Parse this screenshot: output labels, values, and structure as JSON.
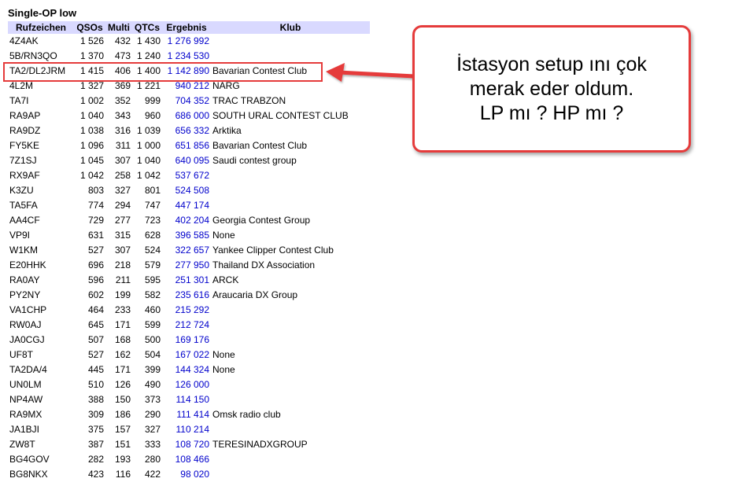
{
  "page": {
    "title": "Single-OP low"
  },
  "table": {
    "headers": [
      "Rufzeichen",
      "QSOs",
      "Multi",
      "QTCs",
      "Ergebnis",
      "Klub"
    ],
    "rows": [
      {
        "call": "4Z4AK",
        "qsos": "1 526",
        "multi": "432",
        "qtcs": "1 430",
        "score": "1 276 992",
        "club": ""
      },
      {
        "call": "5B/RN3QO",
        "qsos": "1 370",
        "multi": "473",
        "qtcs": "1 240",
        "score": "1 234 530",
        "club": ""
      },
      {
        "call": "TA2/DL2JRM",
        "qsos": "1 415",
        "multi": "406",
        "qtcs": "1 400",
        "score": "1 142 890",
        "club": "Bavarian Contest Club"
      },
      {
        "call": "4L2M",
        "qsos": "1 327",
        "multi": "369",
        "qtcs": "1 221",
        "score": "940 212",
        "club": "NARG"
      },
      {
        "call": "TA7I",
        "qsos": "1 002",
        "multi": "352",
        "qtcs": "999",
        "score": "704 352",
        "club": "TRAC TRABZON"
      },
      {
        "call": "RA9AP",
        "qsos": "1 040",
        "multi": "343",
        "qtcs": "960",
        "score": "686 000",
        "club": "SOUTH URAL CONTEST CLUB"
      },
      {
        "call": "RA9DZ",
        "qsos": "1 038",
        "multi": "316",
        "qtcs": "1 039",
        "score": "656 332",
        "club": "Arktika"
      },
      {
        "call": "FY5KE",
        "qsos": "1 096",
        "multi": "311",
        "qtcs": "1 000",
        "score": "651 856",
        "club": "Bavarian Contest Club"
      },
      {
        "call": "7Z1SJ",
        "qsos": "1 045",
        "multi": "307",
        "qtcs": "1 040",
        "score": "640 095",
        "club": "Saudi contest group"
      },
      {
        "call": "RX9AF",
        "qsos": "1 042",
        "multi": "258",
        "qtcs": "1 042",
        "score": "537 672",
        "club": ""
      },
      {
        "call": "K3ZU",
        "qsos": "803",
        "multi": "327",
        "qtcs": "801",
        "score": "524 508",
        "club": ""
      },
      {
        "call": "TA5FA",
        "qsos": "774",
        "multi": "294",
        "qtcs": "747",
        "score": "447 174",
        "club": ""
      },
      {
        "call": "AA4CF",
        "qsos": "729",
        "multi": "277",
        "qtcs": "723",
        "score": "402 204",
        "club": "Georgia Contest Group"
      },
      {
        "call": "VP9I",
        "qsos": "631",
        "multi": "315",
        "qtcs": "628",
        "score": "396 585",
        "club": "None"
      },
      {
        "call": "W1KM",
        "qsos": "527",
        "multi": "307",
        "qtcs": "524",
        "score": "322 657",
        "club": "Yankee Clipper Contest Club"
      },
      {
        "call": "E20HHK",
        "qsos": "696",
        "multi": "218",
        "qtcs": "579",
        "score": "277 950",
        "club": "Thailand DX Association"
      },
      {
        "call": "RA0AY",
        "qsos": "596",
        "multi": "211",
        "qtcs": "595",
        "score": "251 301",
        "club": "ARCK"
      },
      {
        "call": "PY2NY",
        "qsos": "602",
        "multi": "199",
        "qtcs": "582",
        "score": "235 616",
        "club": "Araucaria DX Group"
      },
      {
        "call": "VA1CHP",
        "qsos": "464",
        "multi": "233",
        "qtcs": "460",
        "score": "215 292",
        "club": ""
      },
      {
        "call": "RW0AJ",
        "qsos": "645",
        "multi": "171",
        "qtcs": "599",
        "score": "212 724",
        "club": ""
      },
      {
        "call": "JA0CGJ",
        "qsos": "507",
        "multi": "168",
        "qtcs": "500",
        "score": "169 176",
        "club": ""
      },
      {
        "call": "UF8T",
        "qsos": "527",
        "multi": "162",
        "qtcs": "504",
        "score": "167 022",
        "club": "None"
      },
      {
        "call": "TA2DA/4",
        "qsos": "445",
        "multi": "171",
        "qtcs": "399",
        "score": "144 324",
        "club": "None"
      },
      {
        "call": "UN0LM",
        "qsos": "510",
        "multi": "126",
        "qtcs": "490",
        "score": "126 000",
        "club": ""
      },
      {
        "call": "NP4AW",
        "qsos": "388",
        "multi": "150",
        "qtcs": "373",
        "score": "114 150",
        "club": ""
      },
      {
        "call": "RA9MX",
        "qsos": "309",
        "multi": "186",
        "qtcs": "290",
        "score": "111 414",
        "club": "Omsk radio club"
      },
      {
        "call": "JA1BJI",
        "qsos": "375",
        "multi": "157",
        "qtcs": "327",
        "score": "110 214",
        "club": ""
      },
      {
        "call": "ZW8T",
        "qsos": "387",
        "multi": "151",
        "qtcs": "333",
        "score": "108 720",
        "club": "TERESINADXGROUP"
      },
      {
        "call": "BG4GOV",
        "qsos": "282",
        "multi": "193",
        "qtcs": "280",
        "score": "108 466",
        "club": ""
      },
      {
        "call": "BG8NKX",
        "qsos": "423",
        "multi": "116",
        "qtcs": "422",
        "score": "98 020",
        "club": ""
      }
    ]
  },
  "annotation": {
    "text": "İstasyon setup ını çok\nmerak eder oldum.\nLP mı ? HP mı ?",
    "color": "#e53b3b"
  }
}
